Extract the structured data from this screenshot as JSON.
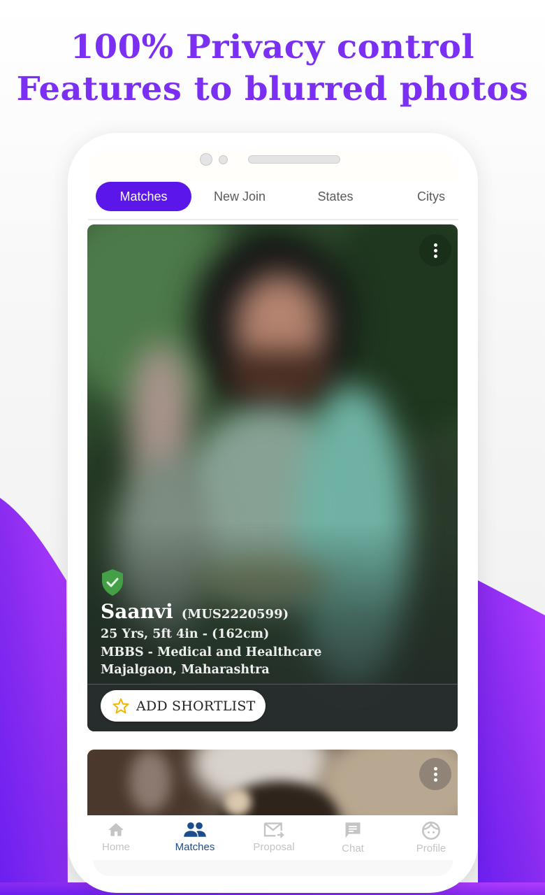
{
  "headline": {
    "line1": "100% Privacy control",
    "line2": "Features to blurred photos"
  },
  "colors": {
    "accent": "#5b16ea",
    "headline": "#7b2ff2",
    "nav_active": "#1b4d8c",
    "nav_inactive": "#c4c4c4",
    "verified": "#43a047",
    "star": "#f5b400"
  },
  "tabs": [
    {
      "label": "Matches",
      "active": true
    },
    {
      "label": "New Join",
      "active": false
    },
    {
      "label": "States",
      "active": false
    },
    {
      "label": "Citys",
      "active": false
    }
  ],
  "profile_card": {
    "photo_state": "blurred",
    "verified_icon": "shield-check-icon",
    "more_icon": "more-vertical-icon",
    "name": "Saanvi",
    "profile_id": "(MUS2220599)",
    "age_height": "25 Yrs, 5ft 4in - (162cm)",
    "education": "MBBS - Medical and Healthcare",
    "location": "Majalgaon, Maharashtra",
    "shortlist_label": "ADD SHORTLIST",
    "shortlist_icon": "star-outline-icon"
  },
  "second_card": {
    "more_icon": "more-vertical-icon"
  },
  "bottom_nav": [
    {
      "label": "Home",
      "icon": "home-icon",
      "active": false
    },
    {
      "label": "Matches",
      "icon": "people-icon",
      "active": true
    },
    {
      "label": "Proposal",
      "icon": "mail-forward-icon",
      "active": false
    },
    {
      "label": "Chat",
      "icon": "chat-icon",
      "active": false
    },
    {
      "label": "Profile",
      "icon": "face-icon",
      "active": false
    }
  ]
}
